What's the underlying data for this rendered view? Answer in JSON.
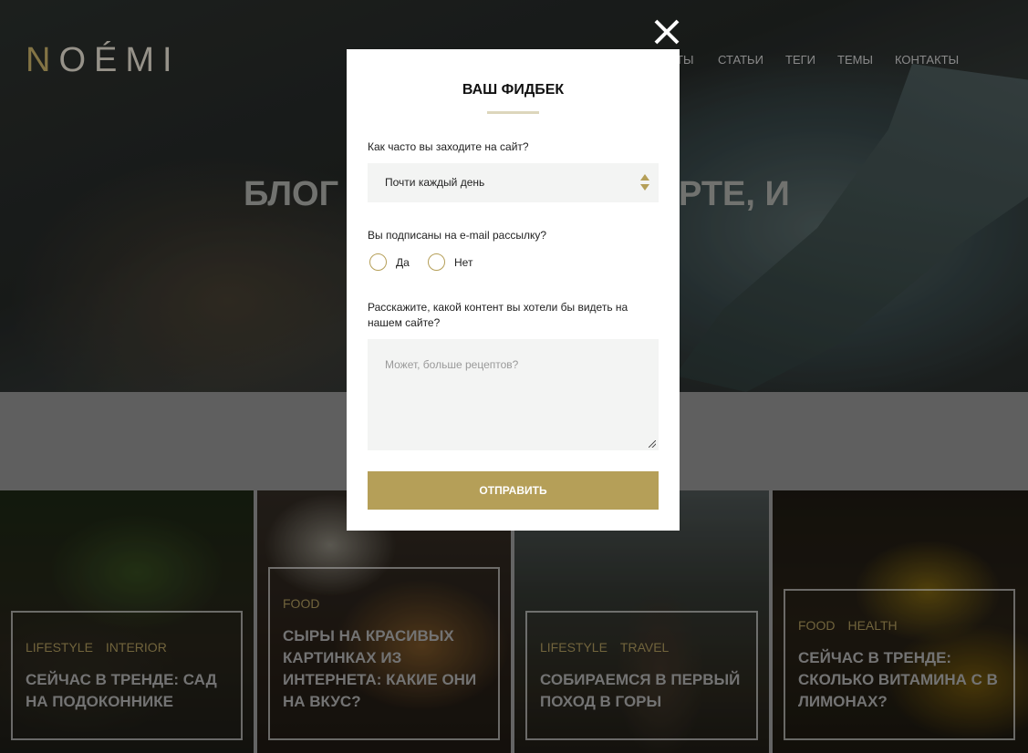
{
  "site": {
    "logo": "NOÉMI"
  },
  "nav": {
    "items": [
      "ТЫ",
      "СТАТЬИ",
      "ТЕГИ",
      "ТЕМЫ",
      "КОНТАКТЫ"
    ]
  },
  "hero": {
    "title_left": "БЛОГ О",
    "title_right": "РТЕ, И"
  },
  "cards": [
    {
      "tags": [
        "LIFESTYLE",
        "INTERIOR"
      ],
      "title": "СЕЙЧАС В ТРЕНДЕ: САД НА ПОДОКОННИКЕ"
    },
    {
      "tags": [
        "FOOD"
      ],
      "title": "СЫРЫ НА КРАСИВЫХ КАРТИНКАХ ИЗ ИНТЕРНЕТА: КАКИЕ ОНИ НА ВКУС?"
    },
    {
      "tags": [
        "LIFESTYLE",
        "TRAVEL"
      ],
      "title": "СОБИРАЕМСЯ В ПЕРВЫЙ ПОХОД В ГОРЫ"
    },
    {
      "tags": [
        "FOOD",
        "HEALTH"
      ],
      "title": "СЕЙЧАС В ТРЕНДЕ: СКОЛЬКО ВИТАМИНА С В ЛИМОНАХ?"
    }
  ],
  "modal": {
    "title": "ВАШ ФИДБЕК",
    "q1": "Как часто вы заходите на сайт?",
    "q1_value": "Почти каждый день",
    "q2": "Вы подписаны на e-mail рассылку?",
    "q2_options": [
      "Да",
      "Нет"
    ],
    "q3": "Расскажите, какой контент вы хотели бы видеть на нашем сайте?",
    "q3_placeholder": "Может, больше рецептов?",
    "submit": "ОТПРАВИТЬ"
  },
  "colors": {
    "accent": "#b59f58",
    "field_bg": "#f3f4f3"
  }
}
